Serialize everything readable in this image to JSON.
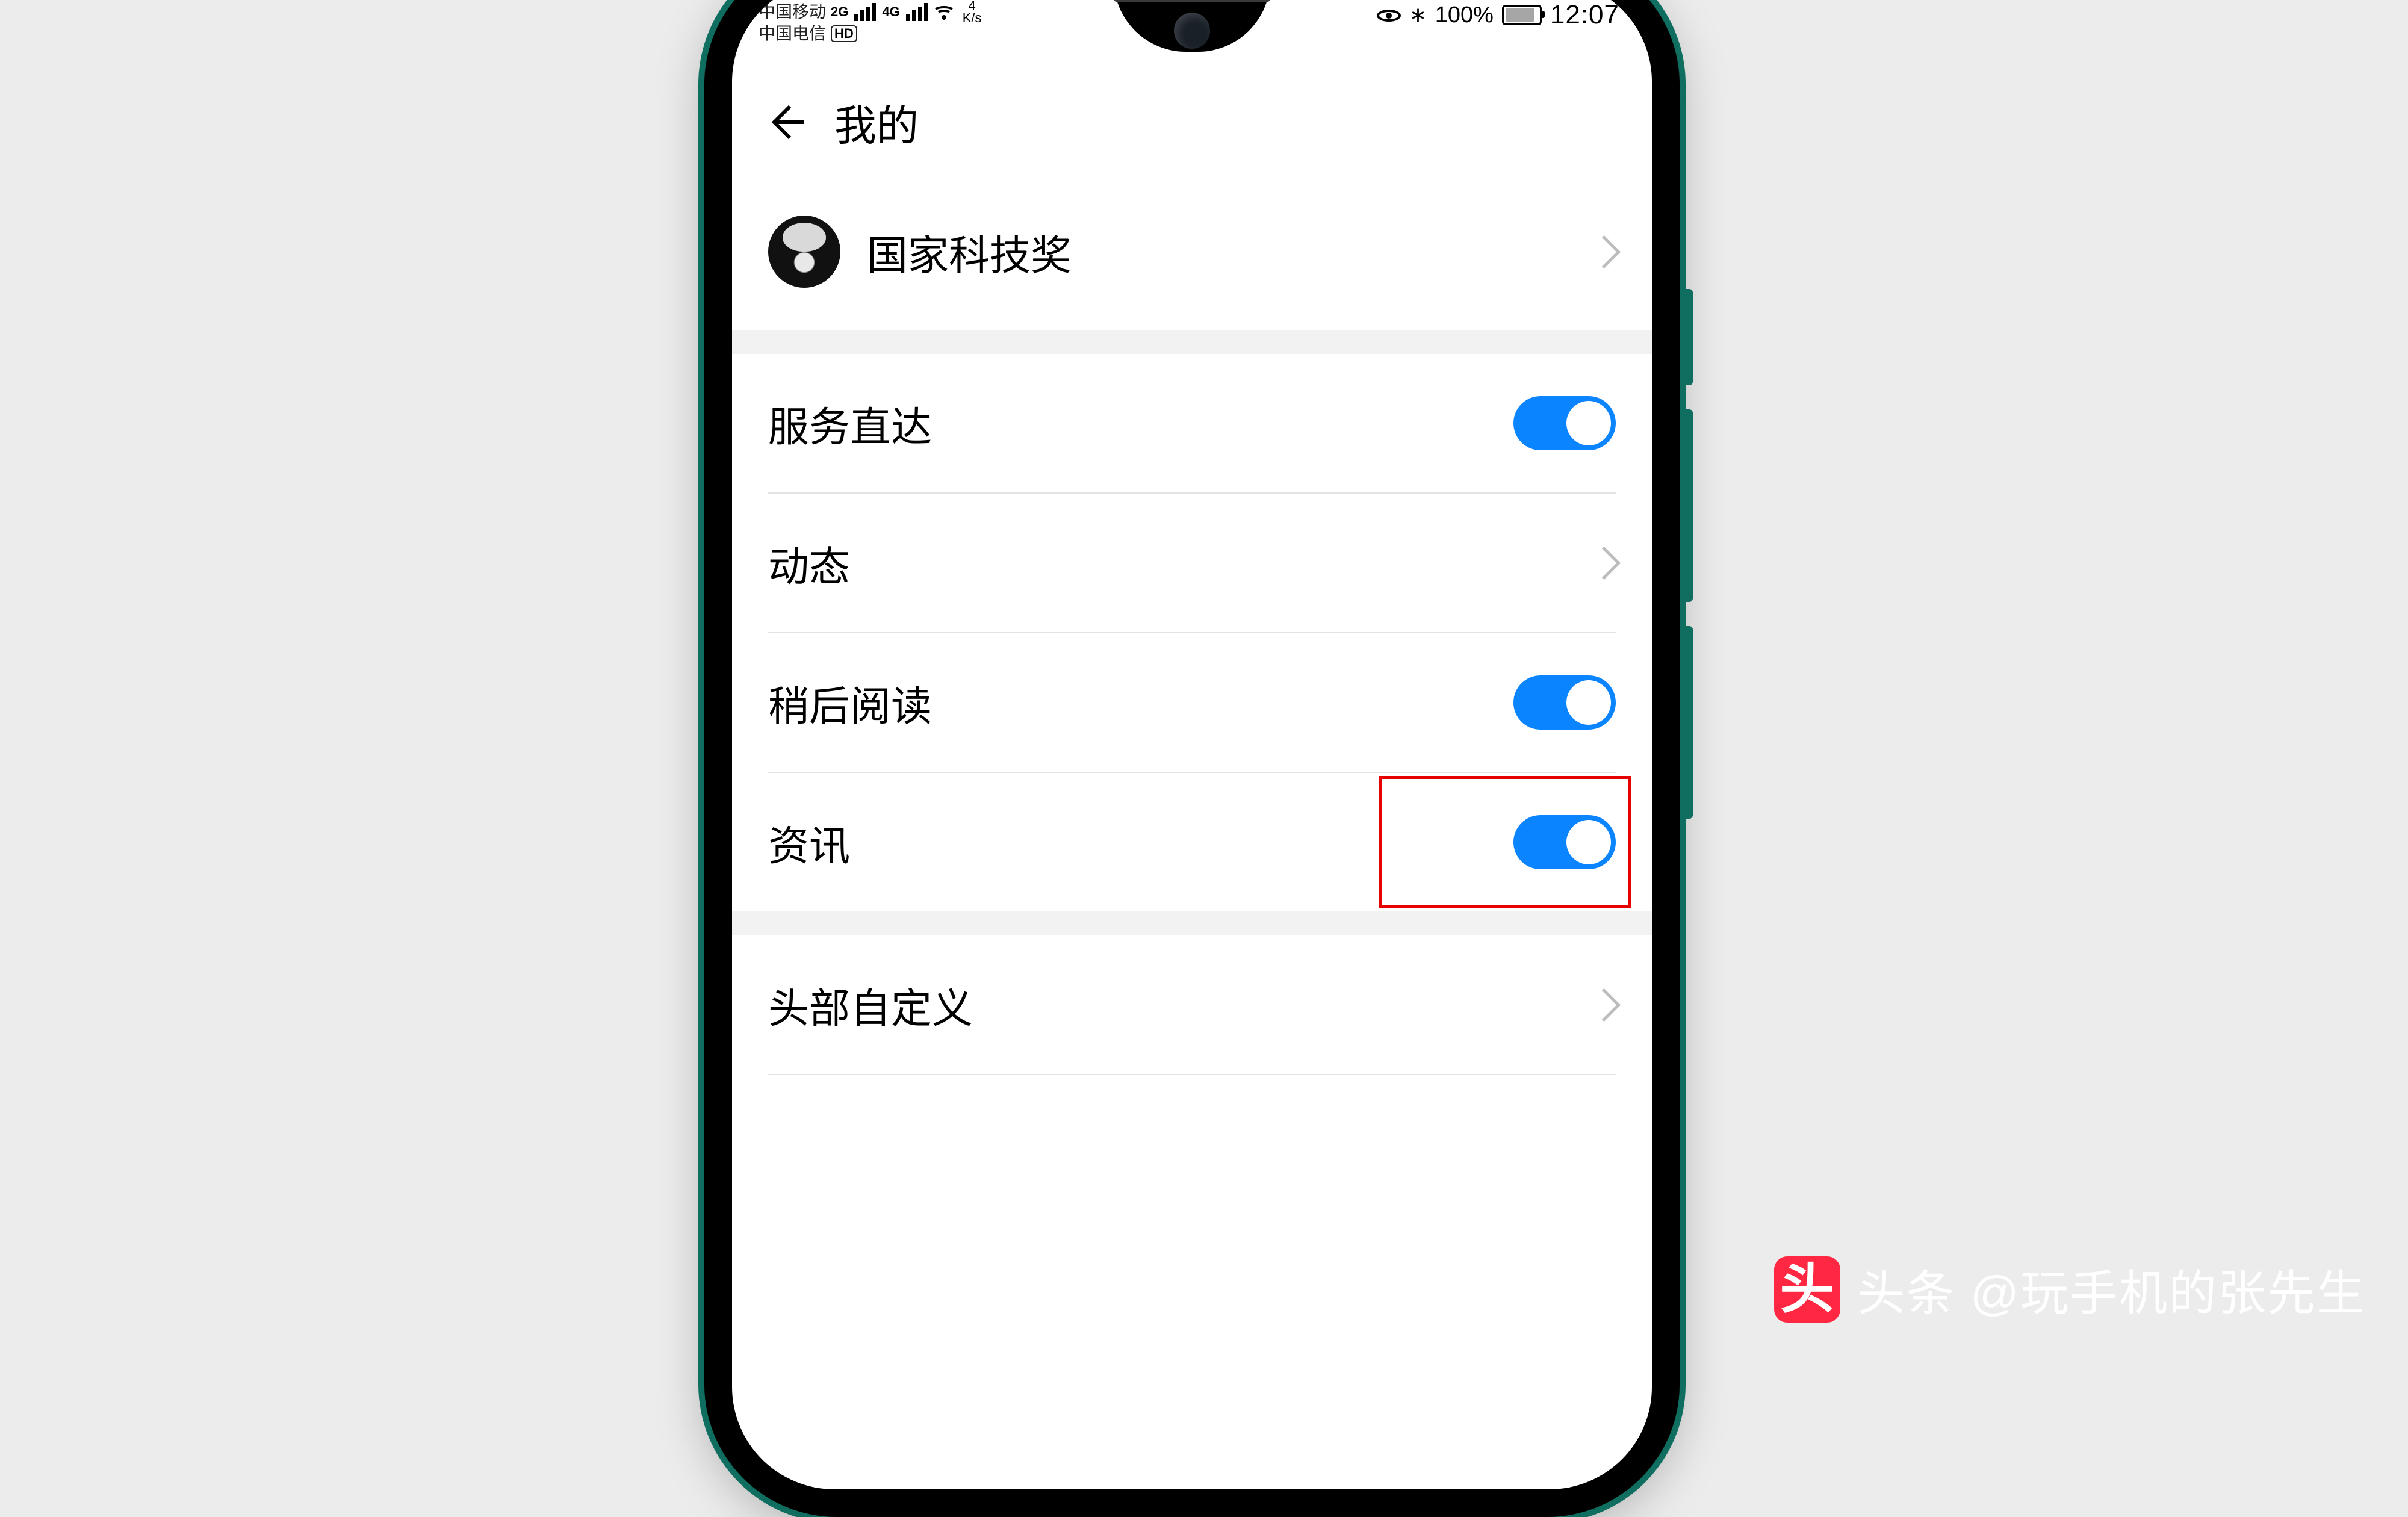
{
  "statusbar": {
    "carrier1": "中国移动",
    "carrier2": "中国电信",
    "hd": "HD",
    "net1": "2G",
    "net2": "4G",
    "speed_value": "4",
    "speed_unit": "K/s",
    "battery_pct": "100%",
    "time": "12:07",
    "bluetooth_glyph": "∗"
  },
  "header": {
    "title": "我的"
  },
  "profile": {
    "name": "国家科技奖"
  },
  "settings": {
    "service_direct": {
      "label": "服务直达",
      "on": true
    },
    "moments": {
      "label": "动态"
    },
    "read_later": {
      "label": "稍后阅读",
      "on": true
    },
    "news": {
      "label": "资讯",
      "on": true,
      "highlighted": true
    },
    "header_customize": {
      "label": "头部自定义"
    }
  },
  "watermark": {
    "logo": "头",
    "prefix": "头条",
    "author": "@玩手机的张先生"
  }
}
